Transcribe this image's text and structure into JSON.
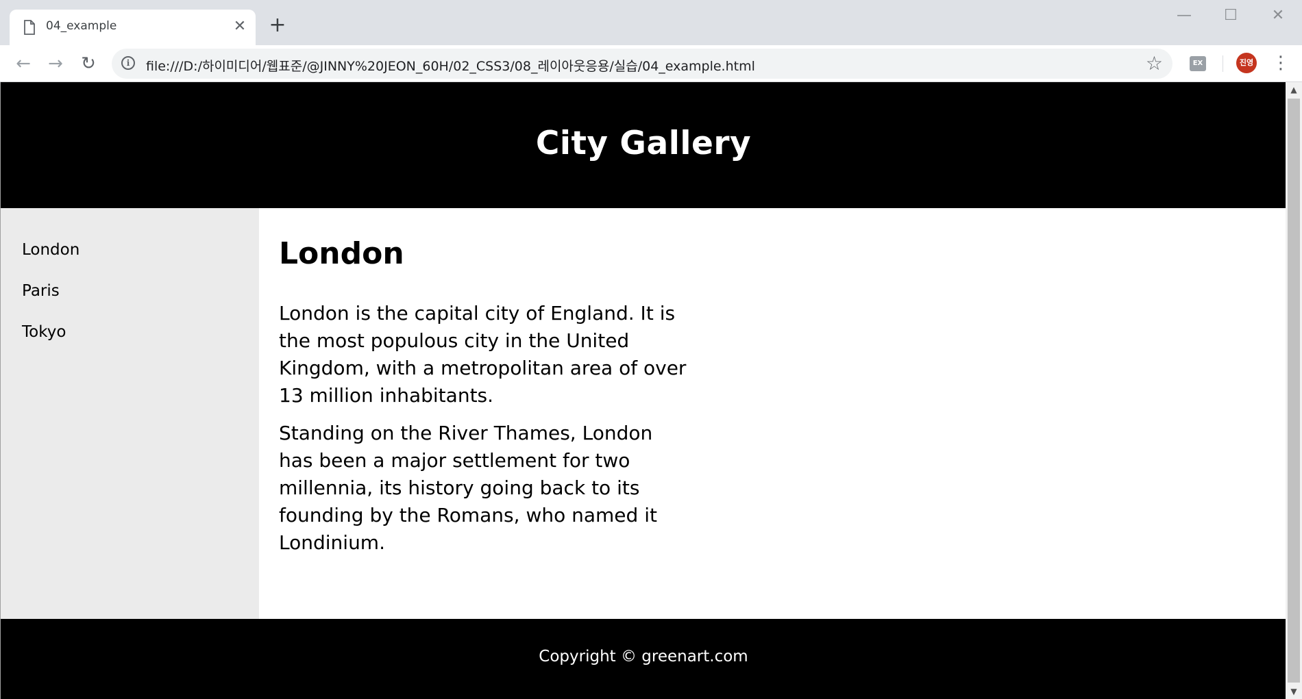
{
  "browser": {
    "tab_title": "04_example",
    "tab_close": "✕",
    "new_tab": "+",
    "window_controls": {
      "minimize": "—",
      "maximize": "☐",
      "close": "✕"
    },
    "nav": {
      "back": "←",
      "forward": "→",
      "reload": "↻"
    },
    "url": "file:///D:/하이미디어/웹표준/@JINNY%20JEON_60H/02_CSS3/08_레이아웃응용/실습/04_example.html",
    "info_icon": "i",
    "star_icon": "☆",
    "extension_label": "EX",
    "avatar_label": "진영",
    "menu_icon": "⋮"
  },
  "page": {
    "header_title": "City Gallery",
    "nav_items": [
      "London",
      "Paris",
      "Tokyo"
    ],
    "article": {
      "title": "London",
      "paragraphs": [
        "London is the capital city of England. It is the most populous city in the United Kingdom, with a metropolitan area of over 13 million inhabitants.",
        "Standing on the River Thames, London has been a major settlement for two millennia, its history going back to its founding by the Romans, who named it Londinium."
      ]
    },
    "footer_text": "Copyright © greenart.com"
  },
  "scrollbar": {
    "up_arrow": "▲",
    "down_arrow": "▼"
  }
}
